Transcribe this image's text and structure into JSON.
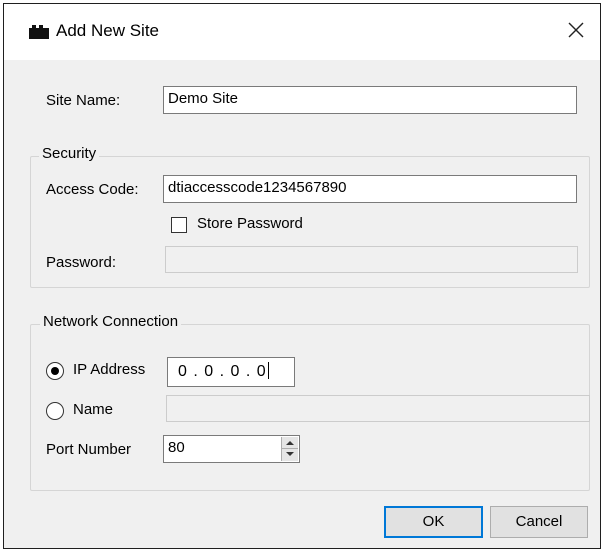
{
  "window": {
    "title": "Add New Site",
    "icon": "folder-icon",
    "close_glyph": "×"
  },
  "site_name": {
    "label": "Site Name:",
    "value": "Demo Site"
  },
  "security": {
    "legend": "Security",
    "access_code_label": "Access Code:",
    "access_code_value": "dtiaccesscode1234567890",
    "store_password_label": "Store Password",
    "store_password_checked": false,
    "password_label": "Password:",
    "password_value": ""
  },
  "network": {
    "legend": "Network Connection",
    "ip_address_label": "IP Address",
    "ip_address_selected": true,
    "ip_address_value": "0 . 0 . 0 . 0",
    "name_label": "Name",
    "name_selected": false,
    "name_value": "",
    "port_label": "Port Number",
    "port_value": "80"
  },
  "buttons": {
    "ok": "OK",
    "cancel": "Cancel"
  },
  "colors": {
    "dialog_background": "#f0f0f0",
    "titlebar_background": "#ffffff",
    "default_button_border": "#0078d7",
    "button_background": "#e1e1e1"
  }
}
